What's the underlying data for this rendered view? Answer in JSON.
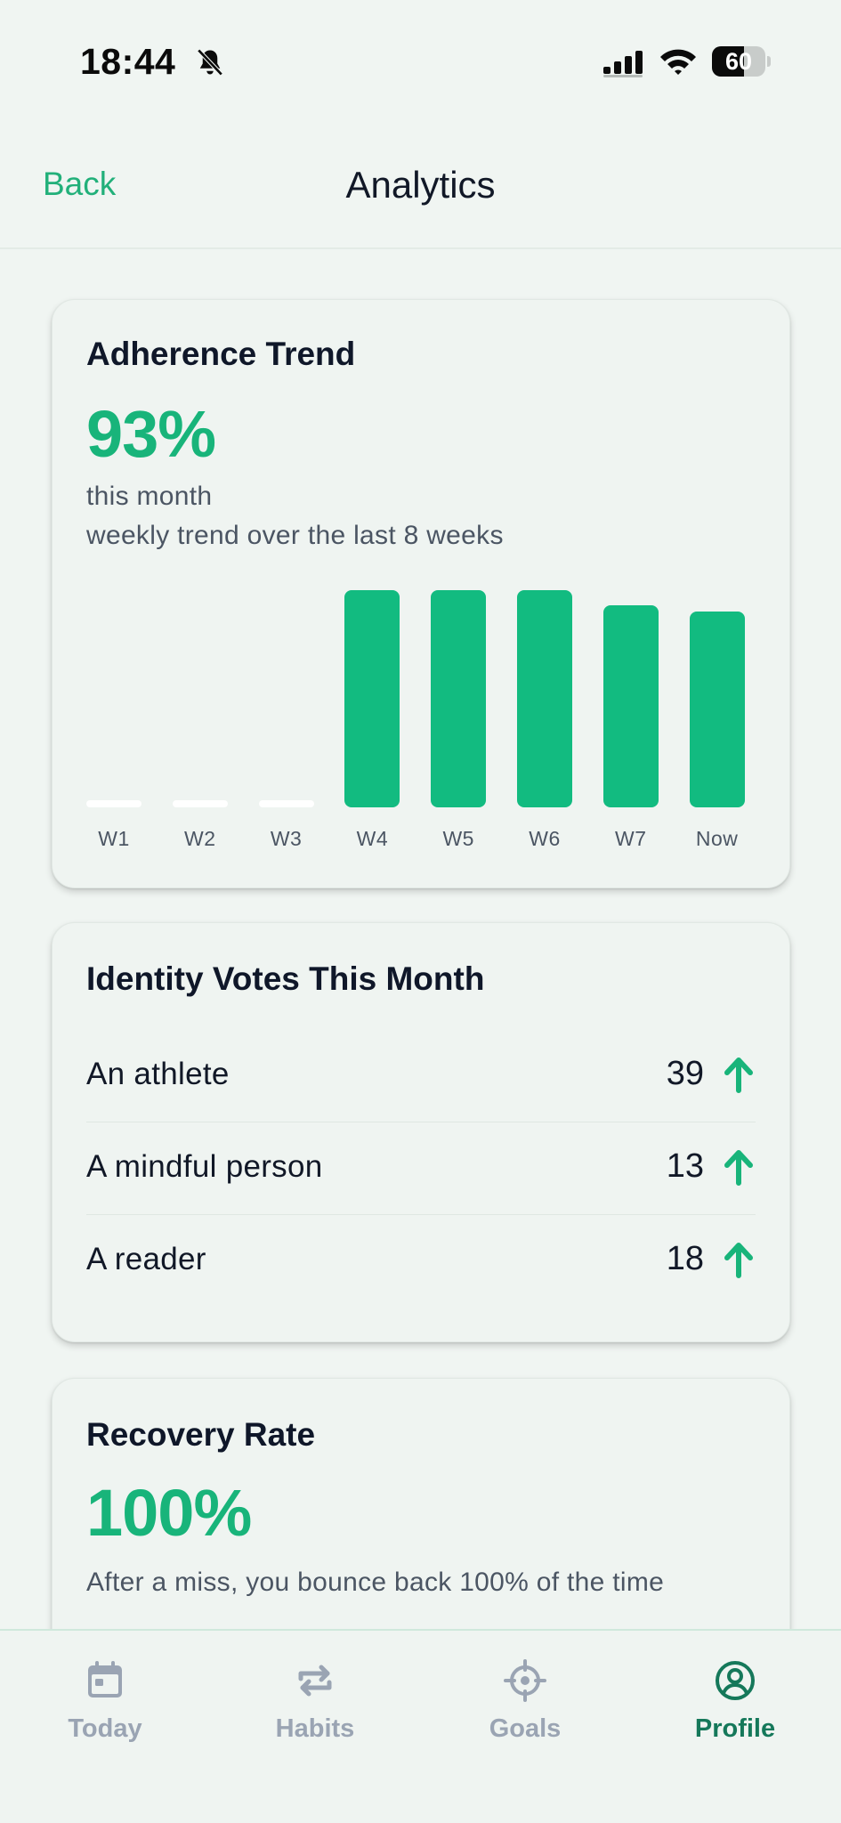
{
  "status_bar": {
    "time": "18:44",
    "battery": "60",
    "battery_level": 0.6
  },
  "header": {
    "back_label": "Back",
    "title": "Analytics"
  },
  "adherence": {
    "title": "Adherence Trend",
    "value": "93%",
    "period": "this month",
    "subtitle": "weekly trend over the last 8 weeks"
  },
  "chart_data": {
    "type": "bar",
    "categories": [
      "W1",
      "W2",
      "W3",
      "W4",
      "W5",
      "W6",
      "W7",
      "Now"
    ],
    "values": [
      0,
      0,
      0,
      100,
      100,
      100,
      93,
      90
    ],
    "ylim": [
      0,
      100
    ],
    "grid": false,
    "bar_color": "#12bb80",
    "empty_color": "#ffffff"
  },
  "identity": {
    "title": "Identity Votes This Month",
    "rows": [
      {
        "label": "An athlete",
        "count": "39",
        "icon": "arrow-up-icon"
      },
      {
        "label": "A mindful person",
        "count": "13",
        "icon": "arrow-up-icon"
      },
      {
        "label": "A reader",
        "count": "18",
        "icon": "arrow-up-icon"
      }
    ]
  },
  "recovery": {
    "title": "Recovery Rate",
    "value": "100%",
    "description": "After a miss, you bounce back 100% of the time"
  },
  "tabs": [
    {
      "label": "Today",
      "icon": "calendar-icon",
      "active": false
    },
    {
      "label": "Habits",
      "icon": "repeat-icon",
      "active": false
    },
    {
      "label": "Goals",
      "icon": "target-icon",
      "active": false
    },
    {
      "label": "Profile",
      "icon": "user-circle-icon",
      "active": true
    }
  ],
  "colors": {
    "accent": "#18b47a",
    "active_tab": "#15785a",
    "inactive_tab": "#9aa4b3",
    "background": "#f0f5f2"
  }
}
